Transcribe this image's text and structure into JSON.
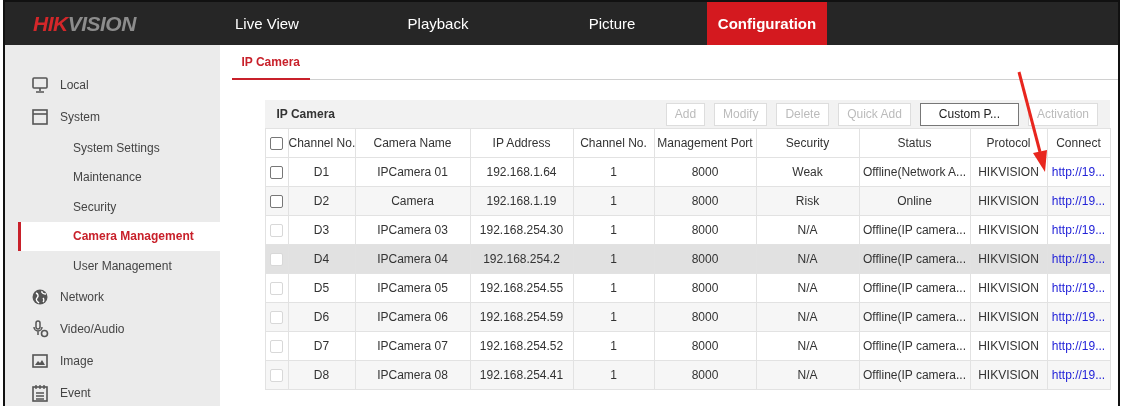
{
  "header": {
    "logo": [
      "HIK",
      "VISION"
    ],
    "tabs": [
      {
        "label": "Live View",
        "selected": false
      },
      {
        "label": "Playback",
        "selected": false
      },
      {
        "label": "Picture",
        "selected": false
      },
      {
        "label": "Configuration",
        "selected": true
      }
    ]
  },
  "sidebar": {
    "items": [
      {
        "label": "Local",
        "selected": false
      },
      {
        "label": "System",
        "selected": false,
        "children": [
          {
            "label": "System Settings",
            "selected": false
          },
          {
            "label": "Maintenance",
            "selected": false
          },
          {
            "label": "Security",
            "selected": false
          },
          {
            "label": "Camera Management",
            "selected": true
          },
          {
            "label": "User Management",
            "selected": false
          }
        ]
      },
      {
        "label": "Network",
        "selected": false
      },
      {
        "label": "Video/Audio",
        "selected": false
      },
      {
        "label": "Image",
        "selected": false
      },
      {
        "label": "Event",
        "selected": false
      }
    ]
  },
  "content_tabs": [
    {
      "label": "IP Camera",
      "selected": true
    }
  ],
  "panel": {
    "title": "IP Camera",
    "buttons": [
      {
        "label": "Add",
        "disabled": true
      },
      {
        "label": "Modify",
        "disabled": true
      },
      {
        "label": "Delete",
        "disabled": true
      },
      {
        "label": "Quick Add",
        "disabled": true
      },
      {
        "label": "Custom P...",
        "disabled": false
      },
      {
        "label": "Activation",
        "disabled": true
      }
    ]
  },
  "table": {
    "select_all": {
      "checked": false
    },
    "columns": [
      {
        "label": "Channel No.",
        "kind": "text"
      },
      {
        "label": "Camera Name",
        "kind": "text"
      },
      {
        "label": "IP Address",
        "kind": "text"
      },
      {
        "label": "Channel No.",
        "kind": "text"
      },
      {
        "label": "Management Port",
        "kind": "text"
      },
      {
        "label": "Security",
        "kind": "text"
      },
      {
        "label": "Status",
        "kind": "text"
      },
      {
        "label": "Protocol",
        "kind": "text"
      },
      {
        "label": "Connect",
        "kind": "link"
      }
    ],
    "rows": [
      {
        "checked": false,
        "disabled": false,
        "highlighted": false,
        "cells": [
          "D1",
          "IPCamera 01",
          "192.168.1.64",
          "1",
          "8000",
          "Weak",
          "Offline(Network A...",
          "HIKVISION",
          "http://19..."
        ]
      },
      {
        "checked": false,
        "disabled": false,
        "highlighted": false,
        "cells": [
          "D2",
          "Camera",
          "192.168.1.19",
          "1",
          "8000",
          "Risk",
          "Online",
          "HIKVISION",
          "http://19..."
        ]
      },
      {
        "checked": false,
        "disabled": true,
        "highlighted": false,
        "cells": [
          "D3",
          "IPCamera 03",
          "192.168.254.30",
          "1",
          "8000",
          "N/A",
          "Offline(IP camera...",
          "HIKVISION",
          "http://19..."
        ]
      },
      {
        "checked": false,
        "disabled": true,
        "highlighted": true,
        "cells": [
          "D4",
          "IPCamera 04",
          "192.168.254.2",
          "1",
          "8000",
          "N/A",
          "Offline(IP camera...",
          "HIKVISION",
          "http://19..."
        ]
      },
      {
        "checked": false,
        "disabled": true,
        "highlighted": false,
        "cells": [
          "D5",
          "IPCamera 05",
          "192.168.254.55",
          "1",
          "8000",
          "N/A",
          "Offline(IP camera...",
          "HIKVISION",
          "http://19..."
        ]
      },
      {
        "checked": false,
        "disabled": true,
        "highlighted": false,
        "cells": [
          "D6",
          "IPCamera 06",
          "192.168.254.59",
          "1",
          "8000",
          "N/A",
          "Offline(IP camera...",
          "HIKVISION",
          "http://19..."
        ]
      },
      {
        "checked": false,
        "disabled": true,
        "highlighted": false,
        "cells": [
          "D7",
          "IPCamera 07",
          "192.168.254.52",
          "1",
          "8000",
          "N/A",
          "Offline(IP camera...",
          "HIKVISION",
          "http://19..."
        ]
      },
      {
        "checked": false,
        "disabled": true,
        "highlighted": false,
        "cells": [
          "D8",
          "IPCamera 08",
          "192.168.254.41",
          "1",
          "8000",
          "N/A",
          "Offline(IP camera...",
          "HIKVISION",
          "http://19..."
        ]
      }
    ]
  },
  "overlay": {
    "kind": "arrow"
  }
}
